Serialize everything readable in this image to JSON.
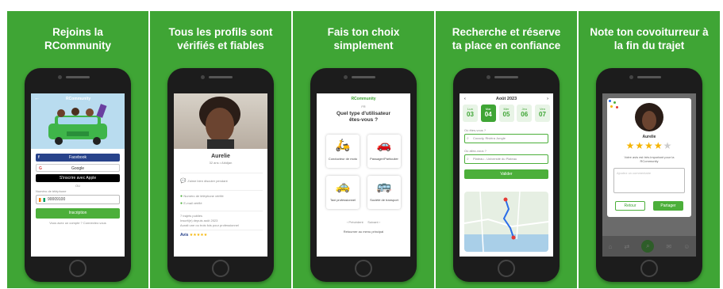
{
  "panels": [
    {
      "title": "Rejoins la\nRCommunity",
      "screen": {
        "logo": "RCommunity",
        "facebook": "Facebook",
        "google": "Google",
        "apple": "S'inscrire avec Apple",
        "or": "OU",
        "phone_label": "Numéro de téléphone",
        "phone_value": "90009100",
        "submit": "Inscription",
        "footer": "Vous avez un compte ? Connectez-vous"
      }
    },
    {
      "title": "Tous les profils sont\nvérifiés et fiables",
      "screen": {
        "name": "Aurelie",
        "subtitle": "32 ans • Abidjan",
        "pref": "J'aime bien discuter pendant",
        "verif1": "Numéro de téléphone vérifié",
        "verif2": "E-mail vérifié",
        "stats1": "7 trajets publiés",
        "stats2": "Inscrit(e) depuis août 2023",
        "stats3": "Aurait une ou trois fois pour professionnel",
        "rating_label": "Avis"
      }
    },
    {
      "title": "Fais ton choix\nsimplement",
      "screen": {
        "logo": "RCommunity",
        "lang": "FR",
        "question": "Quel type d'utilisateur\nêtes-vous ?",
        "options": [
          "Conducteur de moto",
          "Passager/Particulier",
          "Taxi professionnel",
          "Société de transport"
        ],
        "prev": "Précédent",
        "next": "Suivant",
        "back": "Retourner au menu principal"
      }
    },
    {
      "title": "Recherche et réserve\nta place en confiance",
      "screen": {
        "month": "Août 2023",
        "days": [
          {
            "name": "Lun",
            "num": "03"
          },
          {
            "name": "Mar",
            "num": "04"
          },
          {
            "name": "Mer",
            "num": "05"
          },
          {
            "name": "Jeu",
            "num": "06"
          },
          {
            "name": "Ven",
            "num": "07"
          }
        ],
        "from_label": "Où êtes-vous ?",
        "from_value": "Cocody, Riviéra Jungle",
        "to_label": "Où allez-vous ?",
        "to_value": "Plateau - Université du Plateau",
        "submit": "Valider"
      }
    },
    {
      "title": "Note ton covoiturreur à\nla fin du trajet",
      "screen": {
        "name": "Aurelie",
        "rating": 4,
        "rating_max": 5,
        "message": "Votre avis est très important pour la RCommunity",
        "placeholder": "Ajoutez un commentaire",
        "cancel": "Retour",
        "share": "Partager"
      }
    }
  ],
  "colors": {
    "green": "#3fa535",
    "btn_green": "#4caf3a",
    "navy": "#28438b",
    "facebook": "#3b5998"
  }
}
